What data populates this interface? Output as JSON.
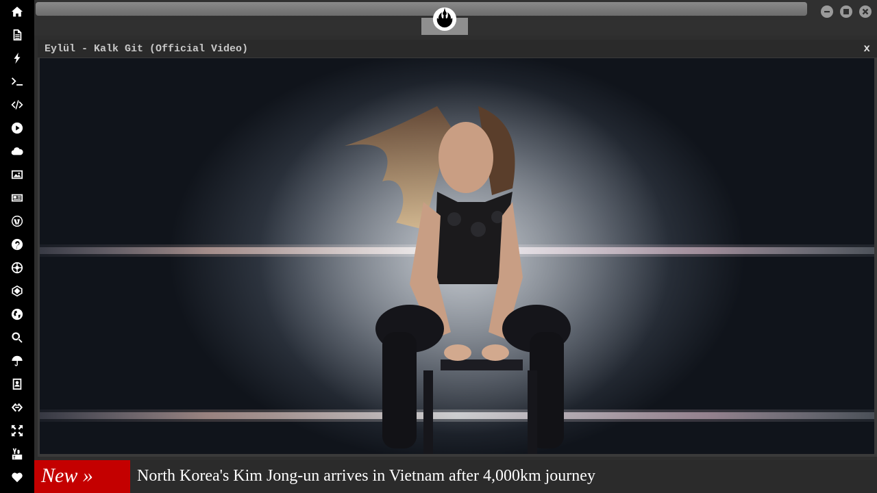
{
  "sidebar": {
    "items": [
      {
        "name": "home-icon"
      },
      {
        "name": "document-icon"
      },
      {
        "name": "bolt-icon"
      },
      {
        "name": "terminal-icon"
      },
      {
        "name": "code-icon"
      },
      {
        "name": "play-circle-icon"
      },
      {
        "name": "cloud-icon"
      },
      {
        "name": "image-icon"
      },
      {
        "name": "newspaper-icon"
      },
      {
        "name": "wordpress-icon"
      },
      {
        "name": "pinterest-icon"
      },
      {
        "name": "empire-icon"
      },
      {
        "name": "cube-icon"
      },
      {
        "name": "globe-icon"
      },
      {
        "name": "search-icon"
      },
      {
        "name": "umbrella-icon"
      },
      {
        "name": "contact-book-icon"
      },
      {
        "name": "link-icon"
      },
      {
        "name": "fullscreen-icon"
      },
      {
        "name": "youtube-icon"
      },
      {
        "name": "heart-icon"
      }
    ]
  },
  "header": {
    "logo": "rebel-alliance-icon",
    "window_controls": [
      "minimize-icon",
      "maximize-icon",
      "close-icon"
    ]
  },
  "player": {
    "title": "Eylül - Kalk Git (Official Video)",
    "close_label": "x"
  },
  "news": {
    "badge": "New »",
    "headline": "North Korea's Kim Jong-un arrives in Vietnam after 4,000km journey"
  },
  "colors": {
    "sidebar_bg": "#000000",
    "accent_badge": "#c40000",
    "frame_bg": "#2e2e2e"
  }
}
